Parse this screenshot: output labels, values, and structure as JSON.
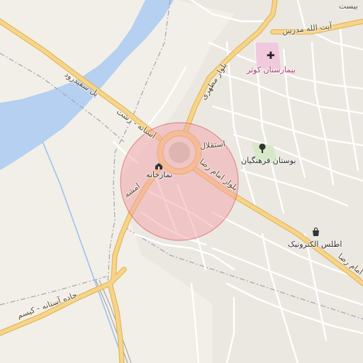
{
  "colors": {
    "land": "#f2efe9",
    "water": "#b5d0f0",
    "block": "#e6e3dd",
    "street": "#ffffff",
    "major_road": "#f6d58a",
    "major_road_casing": "#e3b85c",
    "railway": "#9a9a9a",
    "highlight_fill": "#f4a3a8",
    "highlight_stroke": "#d55a62",
    "hospital": "#e8b7d0",
    "park": "#d7e8c8"
  },
  "labels": {
    "road_top_right": "بیست",
    "road_ayatollah_modarres": "آیت الله مدرس",
    "road_motahari": "بلوار مطهری",
    "road_sefidrood": "پل سفیدرود",
    "road_astaneh_rasht": "آستانه - رشت",
    "road_esteghlal": "استقلال",
    "road_imam_reza": "بلوار امام رضا",
    "road_imam_reza_east": "امام رضا",
    "road_amshe": "امشه",
    "road_astaneh_kisom": "جاده آستانه - کیسم",
    "poi_hospital": "بیمارستان کوثر",
    "poi_park": "بوستان فرهنگیان",
    "poi_prayer": "نمازخانه",
    "poi_electronics": "اطلس الکترونیک"
  },
  "icons": {
    "hospital": "✚",
    "park": "tree-icon",
    "prayer": "prayer-room-icon",
    "shop": "shopping-bag-icon"
  }
}
